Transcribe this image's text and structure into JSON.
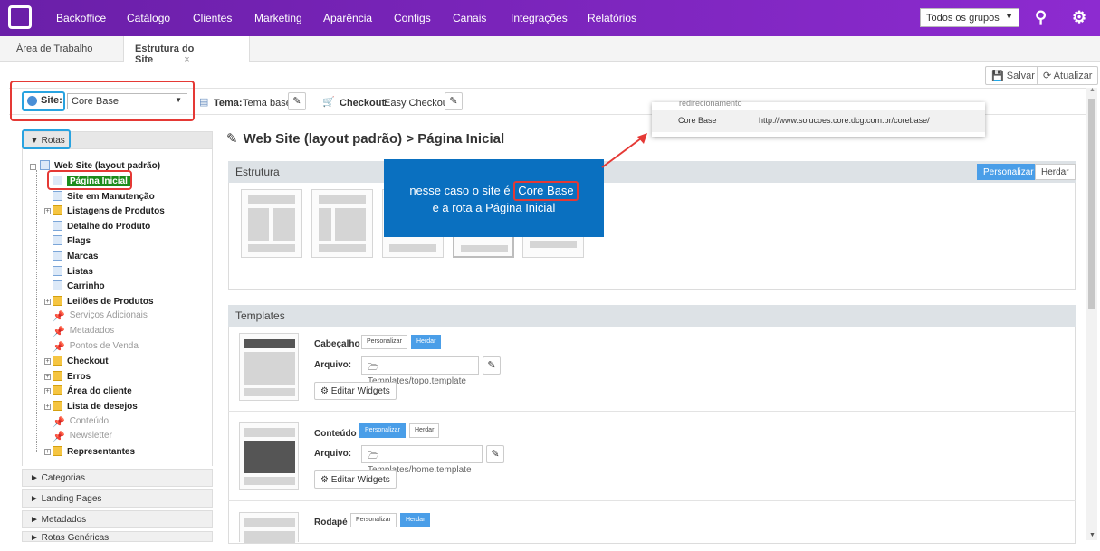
{
  "nav": {
    "items": [
      "Backoffice",
      "Catálogo",
      "Clientes",
      "Marketing",
      "Aparência",
      "Configs",
      "Canais",
      "Integrações",
      "Relatórios"
    ],
    "group_select": "Todos os grupos"
  },
  "tabs": {
    "workspace": "Área de Trabalho",
    "site_structure": "Estrutura do Site",
    "close": "×"
  },
  "toolbar": {
    "save": "Salvar",
    "refresh": "Atualizar"
  },
  "sitebar": {
    "site_label": "Site:",
    "site_value": "Core Base",
    "theme_label": "Tema:",
    "theme_value": "Tema base",
    "checkout_label": "Checkout:",
    "checkout_value": "Easy Checkout"
  },
  "popup": {
    "cut_text": "redirecionamento",
    "site_name": "Core Base",
    "site_url": "http://www.solucoes.core.dcg.com.br/corebase/"
  },
  "sidebar": {
    "routes_header": "▼ Rotas",
    "tree_root": "Web Site (layout padrão)",
    "tree": [
      {
        "label": "Página Inicial",
        "icon": "doc",
        "muted": false,
        "selected": true
      },
      {
        "label": "Site em Manutenção",
        "icon": "doc",
        "muted": false
      },
      {
        "label": "Listagens de Produtos",
        "icon": "folder",
        "muted": false,
        "expandable": true
      },
      {
        "label": "Detalhe do Produto",
        "icon": "doc",
        "muted": false
      },
      {
        "label": "Flags",
        "icon": "doc",
        "muted": false
      },
      {
        "label": "Marcas",
        "icon": "doc",
        "muted": false
      },
      {
        "label": "Listas",
        "icon": "doc",
        "muted": false
      },
      {
        "label": "Carrinho",
        "icon": "doc",
        "muted": false
      },
      {
        "label": "Leilões de Produtos",
        "icon": "folder",
        "muted": false,
        "expandable": true
      },
      {
        "label": "Serviços Adicionais",
        "icon": "pin",
        "muted": true
      },
      {
        "label": "Metadados",
        "icon": "pin",
        "muted": true
      },
      {
        "label": "Pontos de Venda",
        "icon": "pin",
        "muted": true
      },
      {
        "label": "Checkout",
        "icon": "folder",
        "muted": false,
        "expandable": true
      },
      {
        "label": "Erros",
        "icon": "folder",
        "muted": false,
        "expandable": true
      },
      {
        "label": "Área do cliente",
        "icon": "folder",
        "muted": false,
        "expandable": true
      },
      {
        "label": "Lista de desejos",
        "icon": "folder",
        "muted": false,
        "expandable": true
      },
      {
        "label": "Conteúdo",
        "icon": "pin",
        "muted": true
      },
      {
        "label": "Newsletter",
        "icon": "pin",
        "muted": true
      },
      {
        "label": "Representantes",
        "icon": "folder",
        "muted": false,
        "expandable": true
      }
    ],
    "sections": [
      "► Categorias",
      "► Landing Pages",
      "► Metadados",
      "► Rotas Genéricas"
    ]
  },
  "main": {
    "title": "Web Site (layout padrão)  > Página Inicial",
    "estrutura_header": "Estrutura",
    "personalizar": "Personalizar",
    "herdar": "Herdar",
    "templates_header": "Templates",
    "rows": [
      {
        "label": "Cabeçalho",
        "file_label": "Arquivo:",
        "file": "Templates/topo.template",
        "widgets": "Editar Widgets",
        "active": "herdar"
      },
      {
        "label": "Conteúdo",
        "file_label": "Arquivo:",
        "file": "Templates/home.template",
        "widgets": "Editar Widgets",
        "active": "personalizar"
      },
      {
        "label": "Rodapé",
        "file_label": "Arquivo:",
        "file": "",
        "widgets": "",
        "active": "herdar"
      }
    ]
  },
  "callout": {
    "line1_pre": "nesse caso o site é ",
    "line1_hl": "Core Base",
    "line2": "e a rota a Página Inicial"
  }
}
